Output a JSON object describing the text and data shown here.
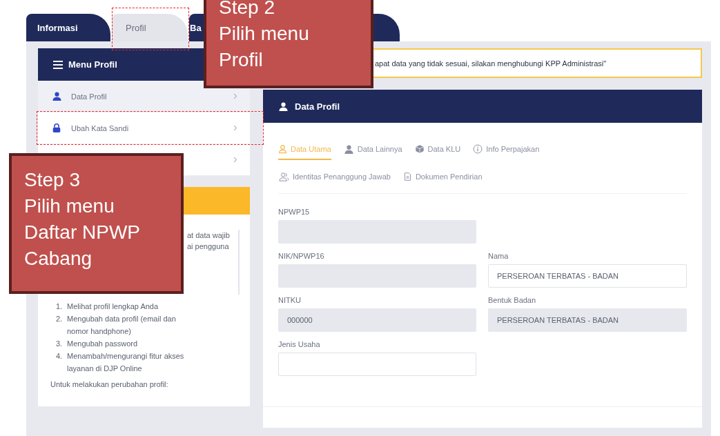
{
  "tabs": [
    {
      "label": "Informasi",
      "selected": false
    },
    {
      "label": "Profil",
      "selected": true
    },
    {
      "label": "Ba",
      "selected": false
    }
  ],
  "menu": {
    "title": "Menu Profil",
    "items": [
      {
        "label": "Data Profil",
        "kind": "person",
        "selected": true
      },
      {
        "label": "Ubah Kata Sandi",
        "kind": "lock",
        "selected": false
      },
      {
        "selected": false
      }
    ]
  },
  "info_card": {
    "fragments": [
      "at data wajib",
      "ai pengguna"
    ],
    "steps": [
      {
        "number": "1.",
        "text": "Melihat profil lengkap Anda"
      },
      {
        "number": "2.",
        "text": "Mengubah data profil (email dan nomor handphone)"
      },
      {
        "number": "3.",
        "text": "Mengubah password"
      },
      {
        "number": "4.",
        "text": "Menambah/mengurangi fitur akses layanan di DJP Online"
      }
    ],
    "footer_text": "Untuk melakukan perubahan profil:"
  },
  "alert": {
    "text": "apat data yang tidak sesuai, silakan menghubungi KPP Administrasi\""
  },
  "profile_card": {
    "title": "Data Profil",
    "subtabs": [
      {
        "label": "Data Utama",
        "kind": "person-outline",
        "selected": true
      },
      {
        "label": "Data Lainnya",
        "kind": "person",
        "selected": false
      },
      {
        "label": "Data KLU",
        "kind": "box",
        "selected": false
      },
      {
        "label": "Info Perpajakan",
        "kind": "info",
        "selected": false
      },
      {
        "label": "Identitas Penanggung Jawab",
        "kind": "people",
        "selected": false
      },
      {
        "label": "Dokumen Pendirian",
        "kind": "document",
        "selected": false
      }
    ],
    "fields": [
      {
        "label": "NPWP15",
        "readonly": true
      },
      {
        "label": "NIK/NPWP16",
        "readonly": true
      },
      {
        "label": "Nama",
        "value": "PERSEROAN TERBATAS - BADAN",
        "readonly": false
      },
      {
        "label": "NITKU",
        "value": "000000",
        "readonly": true
      },
      {
        "label": "Bentuk Badan",
        "value": "PERSEROAN TERBATAS - BADAN",
        "readonly": true
      },
      {
        "label": "Jenis Usaha",
        "readonly": false
      }
    ]
  },
  "annotations": [
    {
      "kind": "callout",
      "lines": [
        "Step 2",
        "Pilih menu",
        "Profil"
      ]
    },
    {
      "kind": "callout",
      "lines": [
        "Step 3",
        "Pilih menu",
        "Daftar NPWP",
        "Cabang"
      ]
    }
  ]
}
